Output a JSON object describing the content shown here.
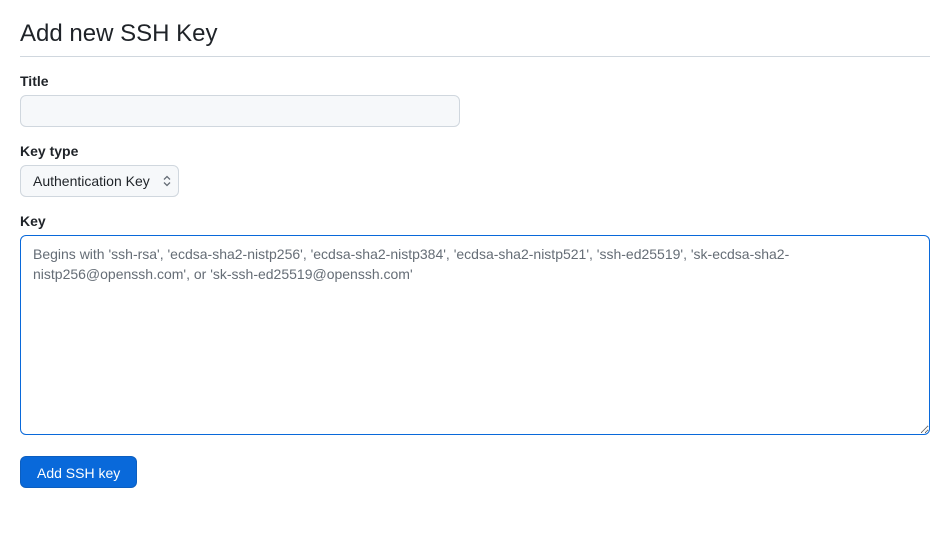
{
  "heading": "Add new SSH Key",
  "form": {
    "title": {
      "label": "Title",
      "value": ""
    },
    "key_type": {
      "label": "Key type",
      "selected": "Authentication Key"
    },
    "key": {
      "label": "Key",
      "value": "",
      "placeholder": "Begins with 'ssh-rsa', 'ecdsa-sha2-nistp256', 'ecdsa-sha2-nistp384', 'ecdsa-sha2-nistp521', 'ssh-ed25519', 'sk-ecdsa-sha2-nistp256@openssh.com', or 'sk-ssh-ed25519@openssh.com'"
    },
    "submit_label": "Add SSH key"
  }
}
